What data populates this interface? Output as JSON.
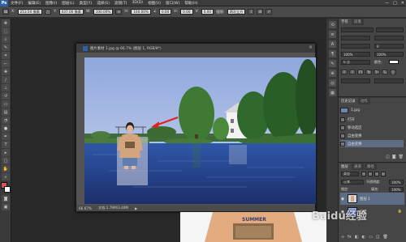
{
  "app": {
    "logo": "Ps"
  },
  "menubar": {
    "items": [
      "文件(F)",
      "编辑(E)",
      "图像(I)",
      "图层(L)",
      "类型(Y)",
      "选择(S)",
      "滤镜(T)",
      "3D(D)",
      "视图(V)",
      "窗口(W)",
      "帮助(H)"
    ],
    "controls": [
      "—",
      "□",
      "✕"
    ]
  },
  "optionsbar": {
    "x_label": "X:",
    "x_value": "253.50 像素",
    "y_label": "Y:",
    "y_value": "437.00 像素",
    "w_label": "W:",
    "w_value": "100.00%",
    "h_label": "H:",
    "h_value": "100.00%",
    "angle_value": "0.00",
    "hskew_label": "H:",
    "hskew_value": "0.00",
    "vskew_label": "V:",
    "vskew_value": "0.00",
    "interp_label": "插值:",
    "interp_value": "两次立方",
    "cancel_icon": "⊘",
    "commit_icon": "✓"
  },
  "document": {
    "title": "图片素材 1.jpg @ 66.7% (图层 1, RGB/8*)",
    "status_zoom": "66.67%",
    "status_doc": "文档:1.79M/3.40M"
  },
  "character_panel": {
    "tab_char": "字符",
    "tab_para": "段落",
    "font_value": "",
    "size_value": "",
    "tracking_value": "0",
    "scale_v": "100%",
    "scale_h": "100%",
    "baseline": "0 点",
    "color_label": "颜色:"
  },
  "history_panel": {
    "tab_history": "历史记录",
    "tab_actions": "动作",
    "items": [
      "1.jpg",
      "打开",
      "移动选区",
      "自由变换",
      "自由变换"
    ],
    "selected_index": 4
  },
  "layers_panel": {
    "tab_layers": "图层",
    "tab_channels": "通道",
    "tab_paths": "路径",
    "kind_label": "类型",
    "blend_mode": "正常",
    "opacity_label": "不透明度:",
    "opacity_value": "100%",
    "lock_label": "锁定:",
    "fill_label": "填充:",
    "fill_value": "100%",
    "layers": [
      {
        "name": "图层 1",
        "selected": true
      },
      {
        "name": "背景",
        "selected": false
      }
    ]
  },
  "doc2": {
    "shirt_text": "SUMMER"
  },
  "watermark": {
    "text": "Baidu经验"
  },
  "colors": {
    "accent": "#5d6d85",
    "ps_blue": "#2f5fa5",
    "arrow_red": "#e02020"
  }
}
